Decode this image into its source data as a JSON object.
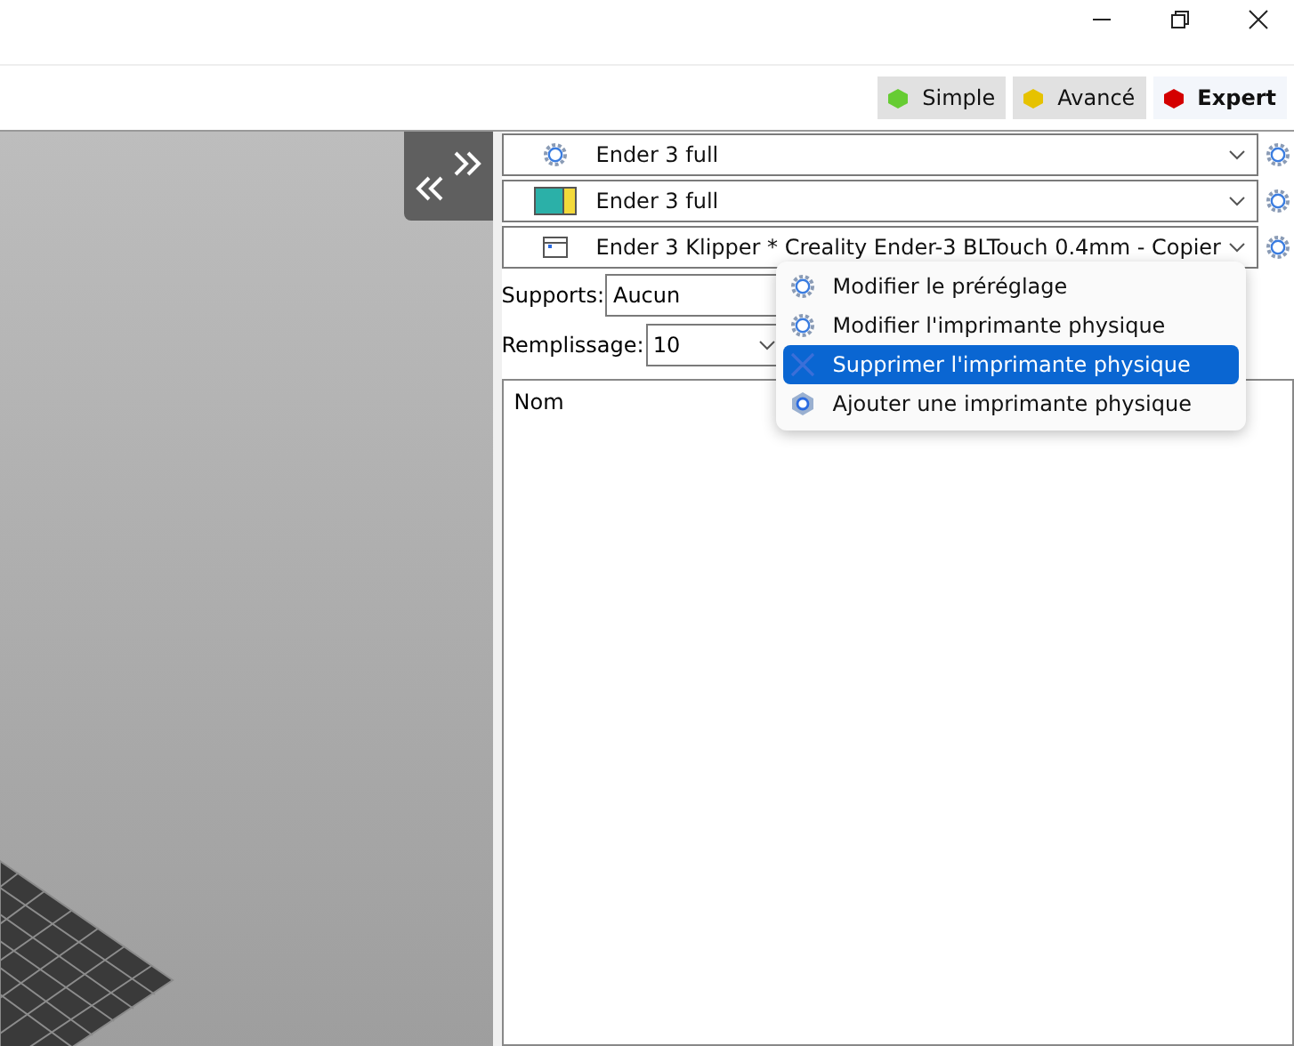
{
  "modes": [
    {
      "label": "Simple",
      "color": "#66cc33",
      "selected": false
    },
    {
      "label": "Avancé",
      "color": "#e6c200",
      "selected": false
    },
    {
      "label": "Expert",
      "color": "#d40000",
      "selected": true
    }
  ],
  "presets": [
    {
      "kind": "print",
      "value": "Ender 3 full"
    },
    {
      "kind": "filament",
      "value": "Ender 3 full"
    },
    {
      "kind": "printer",
      "value": "Ender 3 Klipper * Creality Ender-3 BLTouch 0.4mm - Copier"
    }
  ],
  "supports": {
    "label": "Supports:",
    "value": "Aucun"
  },
  "infill": {
    "label": "Remplissage:",
    "value": "10"
  },
  "object_list": {
    "columns": [
      "Nom"
    ]
  },
  "context_menu": {
    "items": [
      {
        "kind": "gear",
        "label": "Modifier le préréglage",
        "selected": false
      },
      {
        "kind": "gear",
        "label": "Modifier l'imprimante physique",
        "selected": false
      },
      {
        "kind": "delete",
        "label": "Supprimer l'imprimante physique",
        "selected": true
      },
      {
        "kind": "add",
        "label": "Ajouter une imprimante physique",
        "selected": false
      }
    ]
  }
}
